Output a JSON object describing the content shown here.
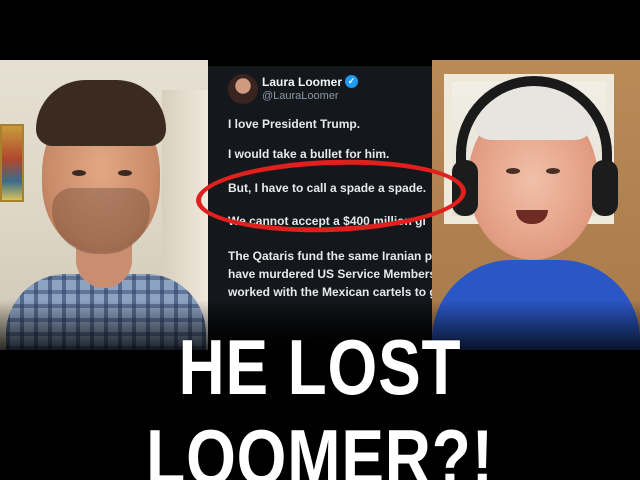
{
  "tweet": {
    "author_name": "Laura Loomer",
    "handle": "@LauraLoomer",
    "verified_badge": "✓",
    "lines": [
      "I love President Trump.",
      "I would take a bullet for him.",
      "But, I have to call a spade a spade.",
      "We cannot accept a $400 million gi",
      "The Qataris fund the same Iranian pr",
      "have murdered US Service Members",
      "worked with the Mexican cartels to g"
    ]
  },
  "highlight": {
    "color": "#e0201c"
  },
  "headline": {
    "text": "HE LOST LOOMER?!"
  }
}
